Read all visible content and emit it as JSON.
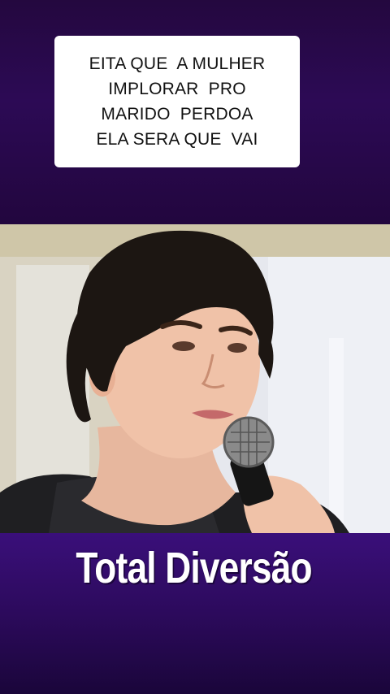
{
  "caption": {
    "text": "EITA QUE  A MULHER\nIMPLORAR  PRO\nMARIDO  PERDOA\nELA SERA QUE  VAI"
  },
  "brand": {
    "text": "Total Diversão"
  },
  "video": {
    "subject": "woman-speaking-into-microphone"
  },
  "colors": {
    "background_purple": "#2c0a55",
    "caption_bg": "#ffffff",
    "brand_text": "#ffffff"
  }
}
